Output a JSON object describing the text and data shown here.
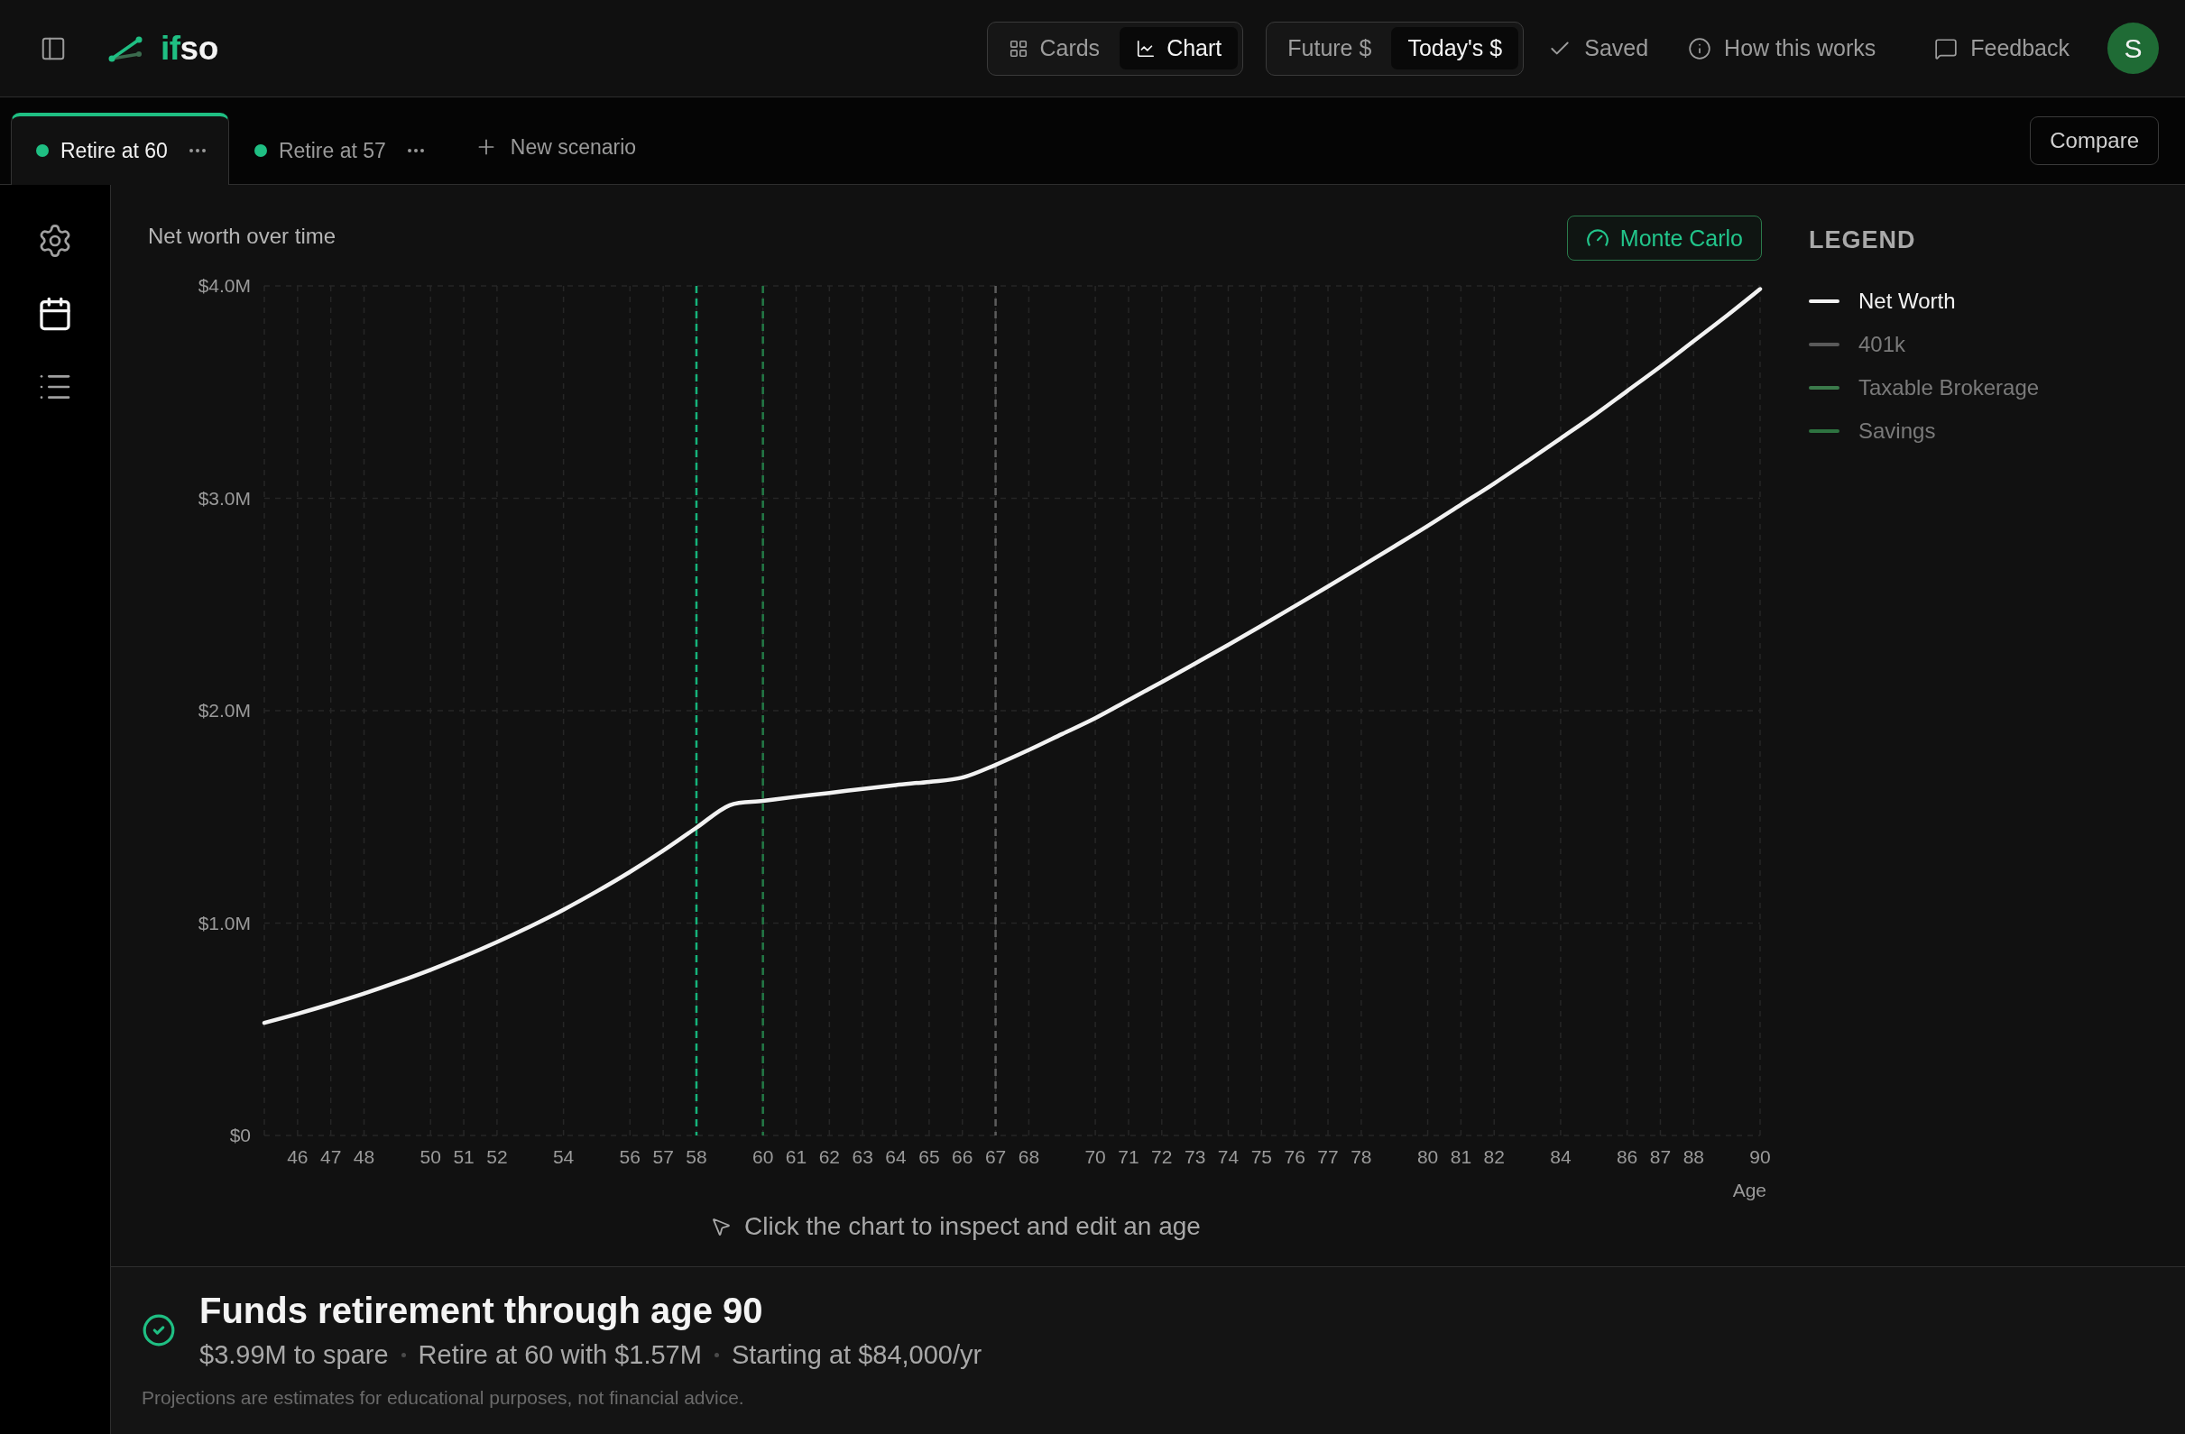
{
  "topbar": {
    "logo": {
      "accent": "if",
      "rest": "so"
    },
    "view_toggle": [
      {
        "kind": "cards",
        "label": "Cards",
        "selected": false
      },
      {
        "kind": "chart",
        "label": "Chart",
        "selected": true
      }
    ],
    "currency_toggle": [
      {
        "label": "Future $",
        "selected": false
      },
      {
        "label": "Today's $",
        "selected": true
      }
    ],
    "save_status": "Saved",
    "help_link": "How this works",
    "feedback_button": "Feedback",
    "avatar_initial": "S"
  },
  "scenario_tabs": [
    {
      "label": "Retire at 60",
      "selected": true
    },
    {
      "label": "Retire at 57",
      "selected": false
    }
  ],
  "new_scenario_button": "New scenario",
  "compare_button": "Compare",
  "sidebar": {
    "items": [
      {
        "kind": "settings",
        "selected": false
      },
      {
        "kind": "calendar",
        "selected": true
      },
      {
        "kind": "list",
        "selected": false
      }
    ]
  },
  "chart_panel": {
    "monte_carlo_button": "Monte Carlo",
    "chart_data": {
      "type": "line",
      "title": "Net worth over time",
      "xlabel": "Age",
      "x": [
        45,
        46,
        47,
        48,
        49,
        50,
        51,
        52,
        53,
        54,
        55,
        56,
        57,
        58,
        59,
        60,
        61,
        62,
        63,
        64,
        65,
        66,
        67,
        68,
        69,
        70,
        71,
        72,
        73,
        74,
        75,
        76,
        77,
        78,
        79,
        80,
        81,
        82,
        83,
        84,
        85,
        86,
        87,
        88,
        89,
        90
      ],
      "series": [
        {
          "color": "#f2f2f2",
          "values": [
            0.53,
            0.573,
            0.619,
            0.668,
            0.722,
            0.78,
            0.843,
            0.911,
            0.984,
            1.063,
            1.149,
            1.241,
            1.341,
            1.449,
            1.555,
            1.575,
            1.595,
            1.613,
            1.632,
            1.65,
            1.665,
            1.685,
            1.745,
            1.815,
            1.89,
            1.965,
            2.05,
            2.135,
            2.222,
            2.31,
            2.4,
            2.492,
            2.585,
            2.679,
            2.774,
            2.87,
            2.97,
            3.07,
            3.175,
            3.282,
            3.39,
            3.505,
            3.62,
            3.74,
            3.86,
            3.985
          ]
        }
      ],
      "xlim": [
        45,
        90
      ],
      "ylim": [
        0,
        4
      ],
      "xticks": [
        46,
        47,
        48,
        50,
        51,
        52,
        54,
        56,
        57,
        58,
        60,
        61,
        62,
        63,
        64,
        65,
        66,
        67,
        68,
        70,
        71,
        72,
        73,
        74,
        75,
        76,
        77,
        78,
        80,
        81,
        82,
        84,
        86,
        87,
        88,
        90
      ],
      "yticks": [
        {
          "value": 4,
          "label": "$4.0M"
        },
        {
          "value": 3,
          "label": "$3.0M"
        },
        {
          "value": 2,
          "label": "$2.0M"
        },
        {
          "value": 1,
          "label": "$1.0M"
        },
        {
          "value": 0,
          "label": "$0"
        }
      ],
      "grid": true,
      "ref_lines": [
        {
          "axis": "x",
          "value": 58,
          "color": "#16b37a"
        },
        {
          "axis": "x",
          "value": 60,
          "color": "#237a46"
        },
        {
          "axis": "x",
          "value": 67,
          "color": "#5c5c5c"
        }
      ]
    },
    "hint": "Click the chart to inspect and edit an age"
  },
  "legend": {
    "heading": "LEGEND",
    "items": [
      {
        "label": "Net Worth",
        "color": "#f2f2f2",
        "visible": true
      },
      {
        "label": "401k",
        "color": "#5a5a5a",
        "visible": false
      },
      {
        "label": "Taxable Brokerage",
        "color": "#3b7a4b",
        "visible": false
      },
      {
        "label": "Savings",
        "color": "#2e7340",
        "visible": false
      }
    ]
  },
  "summary": {
    "title": "Funds retirement through age 90",
    "stats": [
      "$3.99M to spare",
      "Retire at 60 with $1.57M",
      "Starting at $84,000/yr"
    ],
    "disclaimer": "Projections are estimates for educational purposes, not financial advice."
  }
}
